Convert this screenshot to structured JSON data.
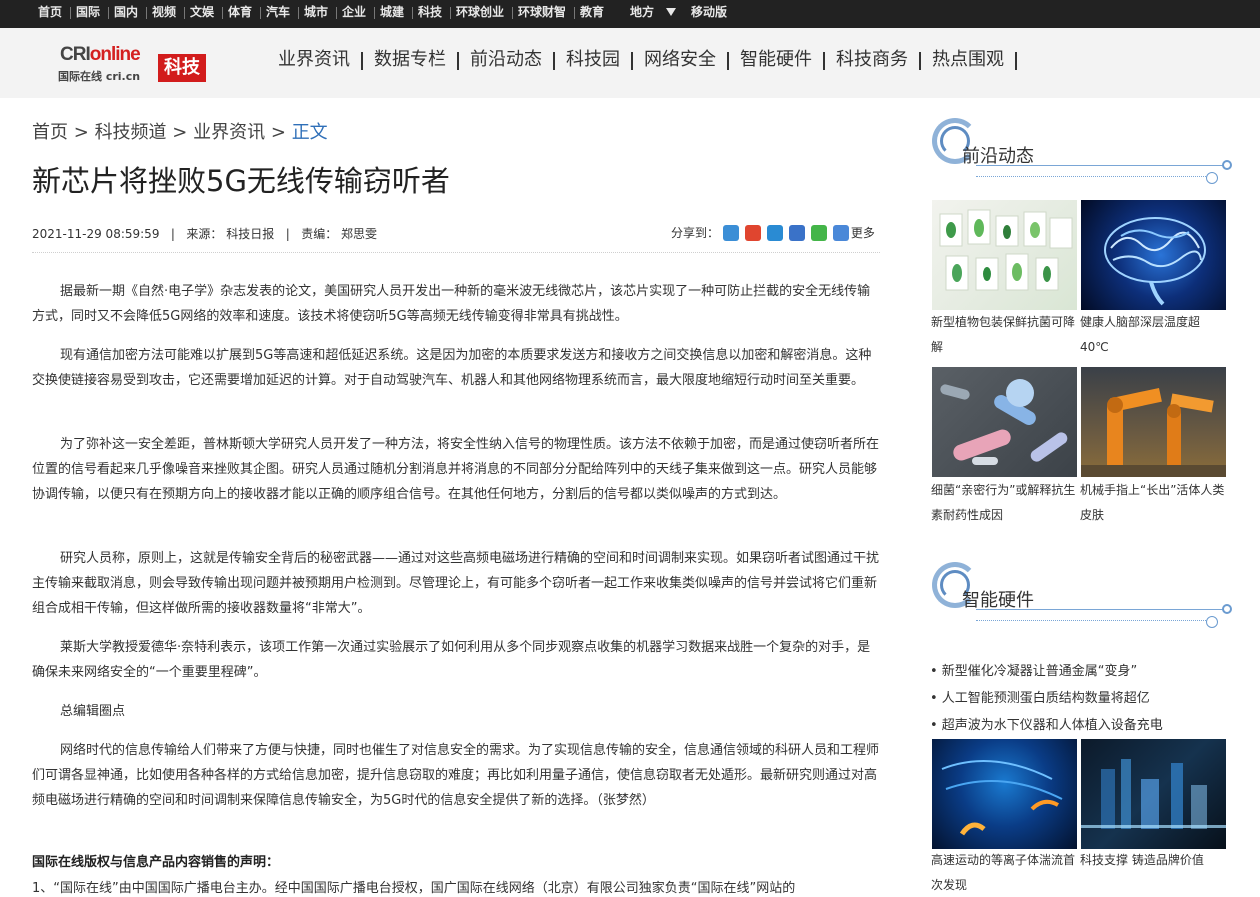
{
  "topnav": {
    "items": [
      "首页",
      "国际",
      "国内",
      "视频",
      "文娱",
      "体育",
      "汽车",
      "城市",
      "企业",
      "城建",
      "科技",
      "环球创业",
      "环球财智",
      "教育",
      "地方",
      "移动版"
    ]
  },
  "logo": {
    "brand_cri": "CRI",
    "brand_online": "online",
    "subtitle": "国际在线 cri.cn",
    "badge": "科技"
  },
  "mainnav": {
    "items": [
      "业界资讯",
      "数据专栏",
      "前沿动态",
      "科技园",
      "网络安全",
      "智能硬件",
      "科技商务",
      "热点围观"
    ]
  },
  "breadcrumb": {
    "home": "首页",
    "channel": "科技频道",
    "section": "业界资讯",
    "current": "正文",
    "sep": ">"
  },
  "article": {
    "title": "新芯片将挫败5G无线传输窃听者",
    "date": "2021-11-29 08:59:59",
    "source": "来源：  科技日报",
    "editor": "责编：  郑思雯",
    "share_label": "分享到：",
    "share_more": "更多",
    "paragraphs": [
      "据最新一期《自然·电子学》杂志发表的论文，美国研究人员开发出一种新的毫米波无线微芯片，该芯片实现了一种可防止拦截的安全无线传输方式，同时又不会降低5G网络的效率和速度。该技术将使窃听5G等高频无线传输变得非常具有挑战性。",
      "现有通信加密方法可能难以扩展到5G等高速和超低延迟系统。这是因为加密的本质要求发送方和接收方之间交换信息以加密和解密消息。这种交换使链接容易受到攻击，它还需要增加延迟的计算。对于自动驾驶汽车、机器人和其他网络物理系统而言，最大限度地缩短行动时间至关重要。",
      "为了弥补这一安全差距，普林斯顿大学研究人员开发了一种方法，将安全性纳入信号的物理性质。该方法不依赖于加密，而是通过使窃听者所在位置的信号看起来几乎像噪音来挫败其企图。研究人员通过随机分割消息并将消息的不同部分分配给阵列中的天线子集来做到这一点。研究人员能够协调传输，以便只有在预期方向上的接收器才能以正确的顺序组合信号。在其他任何地方，分割后的信号都以类似噪声的方式到达。",
      "研究人员称，原则上，这就是传输安全背后的秘密武器——通过对这些高频电磁场进行精确的空间和时间调制来实现。如果窃听者试图通过干扰主传输来截取消息，则会导致传输出现问题并被预期用户检测到。尽管理论上，有可能多个窃听者一起工作来收集类似噪声的信号并尝试将它们重新组合成相干传输，但这样做所需的接收器数量将“非常大”。",
      "莱斯大学教授爱德华·奈特利表示，该项工作第一次通过实验展示了如何利用从多个同步观察点收集的机器学习数据来战胜一个复杂的对手，是确保未来网络安全的“一个重要里程碑”。",
      "总编辑圈点",
      "网络时代的信息传输给人们带来了方便与快捷，同时也催生了对信息安全的需求。为了实现信息传输的安全，信息通信领域的科研人员和工程师们可谓各显神通，比如使用各种各样的方式给信息加密，提升信息窃取的难度；再比如利用量子通信，使信息窃取者无处遁形。最新研究则通过对高频电磁场进行精确的空间和时间调制来保障信息传输安全，为5G时代的信息安全提供了新的选择。（张梦然）"
    ],
    "declaration_title": "国际在线版权与信息产品内容销售的声明：",
    "declaration_line1": "1、“国际在线”由中国国际广播电台主办。经中国国际广播电台授权，国广国际在线网络（北京）有限公司独家负责“国际在线”网站的"
  },
  "sidebar": {
    "frontier": {
      "title": "前沿动态",
      "items": [
        {
          "caption": "新型植物包装保鲜抗菌可降解"
        },
        {
          "caption": "健康人脑部深层温度超40℃"
        },
        {
          "caption": "细菌“亲密行为”或解释抗生素耐药性成因"
        },
        {
          "caption": "机械手指上“长出”活体人类皮肤"
        }
      ]
    },
    "hardware": {
      "title": "智能硬件",
      "bullets": [
        "• 新型催化冷凝器让普通金属“变身”",
        "• 人工智能预测蛋白质结构数量将超亿",
        "• 超声波为水下仪器和人体植入设备充电"
      ],
      "items": [
        {
          "caption": "高速运动的等离子体湍流首次发现"
        },
        {
          "caption": "科技支撑 铸造品牌价值"
        }
      ]
    }
  },
  "colors": {
    "topbar_bg": "#222222",
    "header_bg": "#f3f3f3",
    "badge_red": "#d21c1c",
    "link_blue": "#2f6fb8",
    "accent_blue": "#7aa6d6"
  }
}
